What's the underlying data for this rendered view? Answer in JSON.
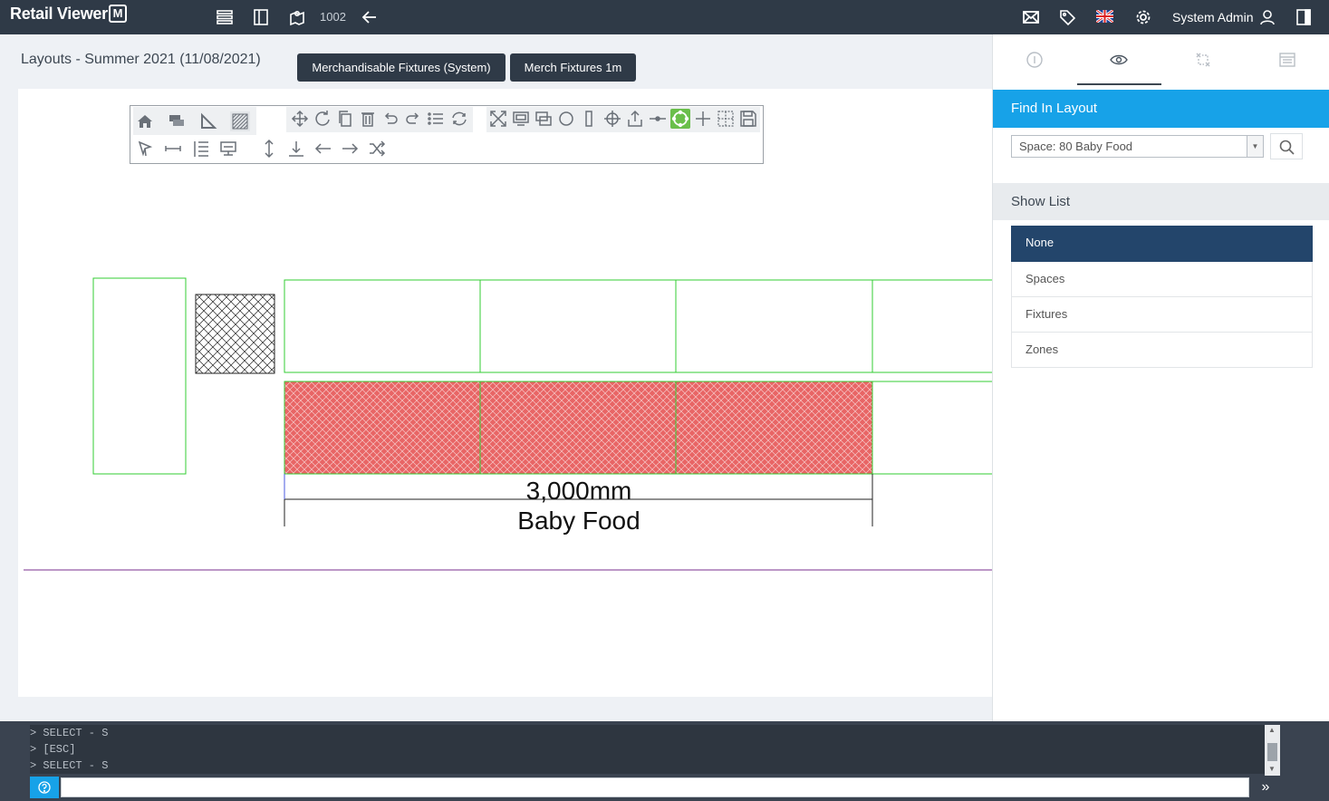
{
  "app": {
    "name": "Retail Viewer",
    "logo_mark": "M"
  },
  "topbar": {
    "store_number": "1002",
    "user_name": "System Admin",
    "icons": [
      "list-icon",
      "panel-icon",
      "map-icon",
      "back-arrow-icon",
      "mail-icon",
      "tag-icon",
      "uk-flag-icon",
      "gear-icon",
      "user-icon",
      "sidebar-toggle-icon"
    ]
  },
  "page": {
    "title": "Layouts - Summer 2021 (11/08/2021)",
    "buttons": {
      "merch_system": "Merchandisable Fixtures (System)",
      "merch_1m": "Merch Fixtures 1m"
    }
  },
  "drawing": {
    "dimension_label": "3,000mm",
    "space_label": "Baby Food",
    "colors": {
      "fixture_outline": "#33cc33",
      "selected_fill": "#e85c5c",
      "guide_line": "#7a2f8f"
    }
  },
  "panel": {
    "find_title": "Find In Layout",
    "find_value": "Space: 80 Baby Food",
    "show_list_title": "Show List",
    "show_list_items": [
      "None",
      "Spaces",
      "Fixtures",
      "Zones"
    ],
    "selected_item": "None"
  },
  "console": {
    "log": [
      "> SELECT - S",
      "> [ESC]",
      "> SELECT - S"
    ],
    "input_value": ""
  }
}
